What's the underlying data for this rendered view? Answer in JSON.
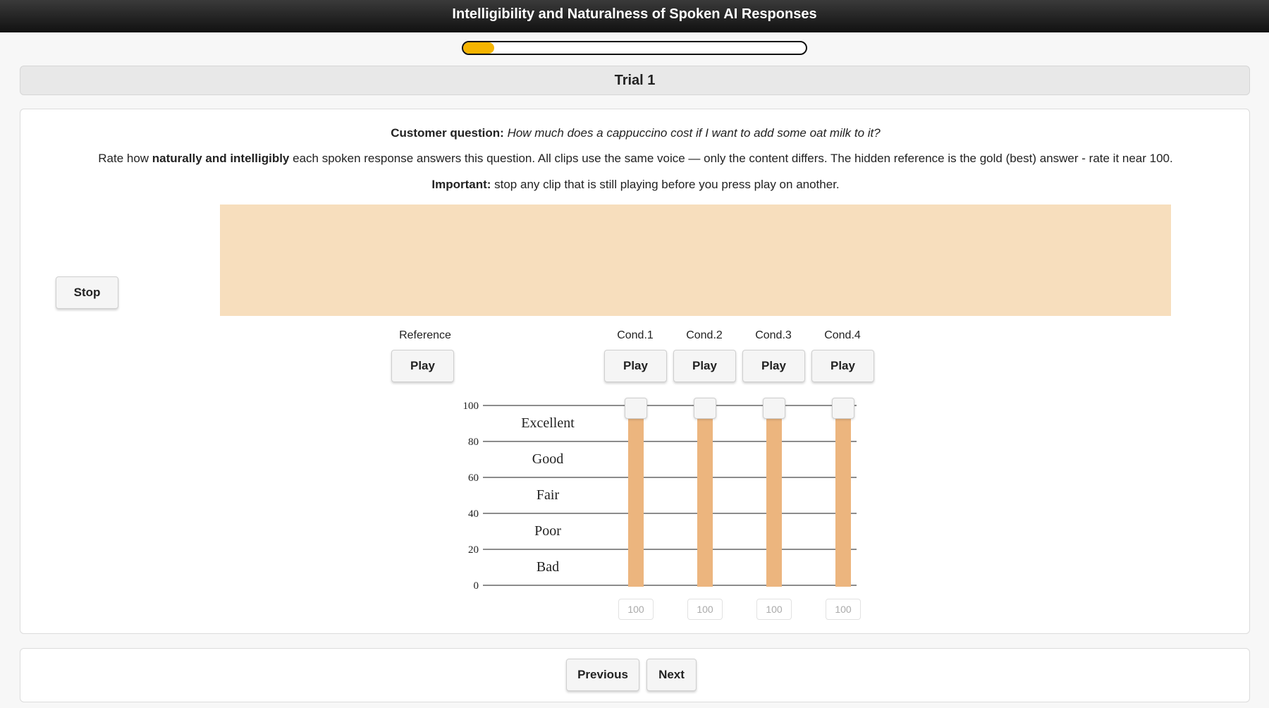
{
  "header": {
    "title": "Intelligibility and Naturalness of Spoken AI Responses"
  },
  "progress": {
    "fraction": 0.09
  },
  "trial": {
    "title": "Trial 1"
  },
  "instructions": {
    "question_label": "Customer question:",
    "question_text": "How much does a cappuccino cost if I want to add some oat milk to it?",
    "rate_prefix": "Rate how ",
    "rate_bold": "naturally and intelligibly",
    "rate_suffix": " each spoken response answers this question. All clips use the same voice — only the content differs. The hidden reference is the gold (best) answer - rate it near 100.",
    "important_label": "Important:",
    "important_text": " stop any clip that is still playing before you press play on another."
  },
  "waveform": {
    "color": "#f7debd"
  },
  "controls": {
    "stop_label": "Stop"
  },
  "reference": {
    "label": "Reference",
    "play_label": "Play"
  },
  "conditions": [
    {
      "label": "Cond.1",
      "play_label": "Play",
      "value": "100"
    },
    {
      "label": "Cond.2",
      "play_label": "Play",
      "value": "100"
    },
    {
      "label": "Cond.3",
      "play_label": "Play",
      "value": "100"
    },
    {
      "label": "Cond.4",
      "play_label": "Play",
      "value": "100"
    }
  ],
  "scale": {
    "ticks": [
      "100",
      "80",
      "60",
      "40",
      "20",
      "0"
    ],
    "categories": [
      "Excellent",
      "Good",
      "Fair",
      "Poor",
      "Bad"
    ]
  },
  "navigation": {
    "previous_label": "Previous",
    "next_label": "Next"
  },
  "colors": {
    "accent": "#f5b400",
    "slider": "#ecb57e",
    "header": "#1a1a1a"
  }
}
